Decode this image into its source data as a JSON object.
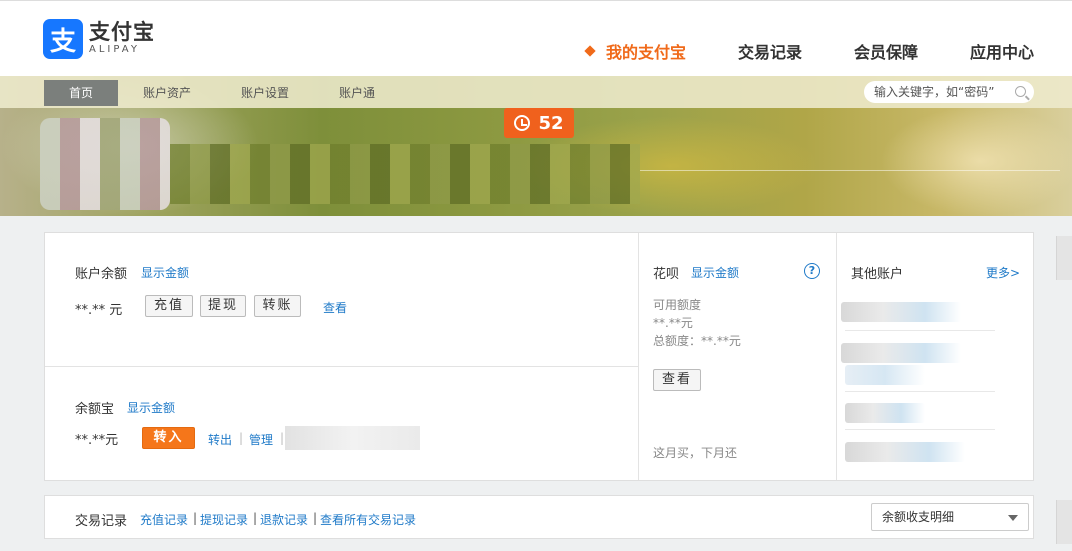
{
  "header": {
    "logo_cn": "支付宝",
    "logo_en": "ALIPAY",
    "logo_mark": "支",
    "nav": [
      {
        "label": "我的支付宝",
        "active": true
      },
      {
        "label": "交易记录",
        "active": false
      },
      {
        "label": "会员保障",
        "active": false
      },
      {
        "label": "应用中心",
        "active": false
      }
    ]
  },
  "subnav": {
    "items": [
      "首页",
      "账户资产",
      "账户设置",
      "账户通"
    ],
    "search_placeholder": "输入关键字，如“密码”"
  },
  "banner": {
    "badge_count": "52"
  },
  "balance": {
    "label": "账户余额",
    "show_link": "显示金额",
    "amount": "**.** 元",
    "recharge": "充值",
    "withdraw": "提现",
    "transfer": "转账",
    "view": "查看"
  },
  "yuebao": {
    "label": "余额宝",
    "show_link": "显示金额",
    "amount": "**.**元",
    "transfer_in": "转入",
    "transfer_out": "转出",
    "sep": "|",
    "manage": "管理"
  },
  "huabei": {
    "label": "花呗",
    "show_link": "显示金额",
    "help": "?",
    "available_label": "可用额度",
    "available_value": "**.**元",
    "total": "总额度：**.**元",
    "view_button": "查看",
    "slogan": "这月买，下月还"
  },
  "other_accounts": {
    "label": "其他账户",
    "more": "更多>"
  },
  "transactions": {
    "label": "交易记录",
    "links": [
      "充值记录",
      "提现记录",
      "退款记录",
      "查看所有交易记录"
    ],
    "sep": "|",
    "select_value": "余额收支明细"
  },
  "colors": {
    "accent_orange": "#f06a1a",
    "link_blue": "#1f7ac8",
    "brand_blue": "#1677ff"
  }
}
